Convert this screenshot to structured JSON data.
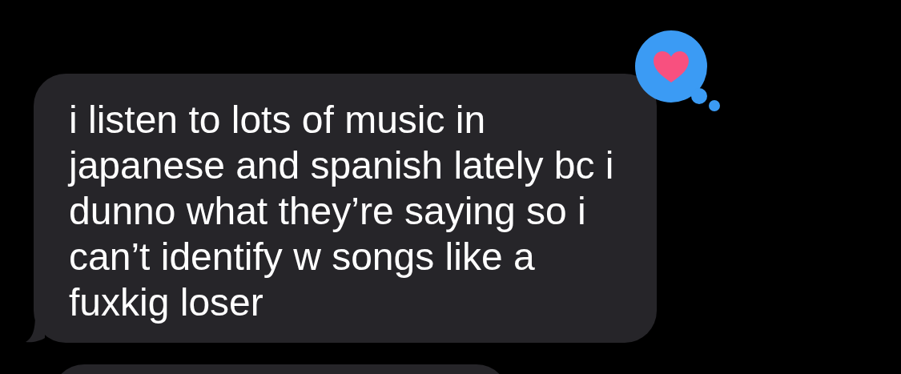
{
  "messages": [
    {
      "kind": "received",
      "text": "i listen to lots of music in\njapanese and spanish lately bc i\ndunno what they’re saying so i\ncan’t identify w songs like a\nfuxkig loser",
      "tapback": {
        "kind": "heart"
      }
    },
    {
      "kind": "received"
    }
  ]
}
